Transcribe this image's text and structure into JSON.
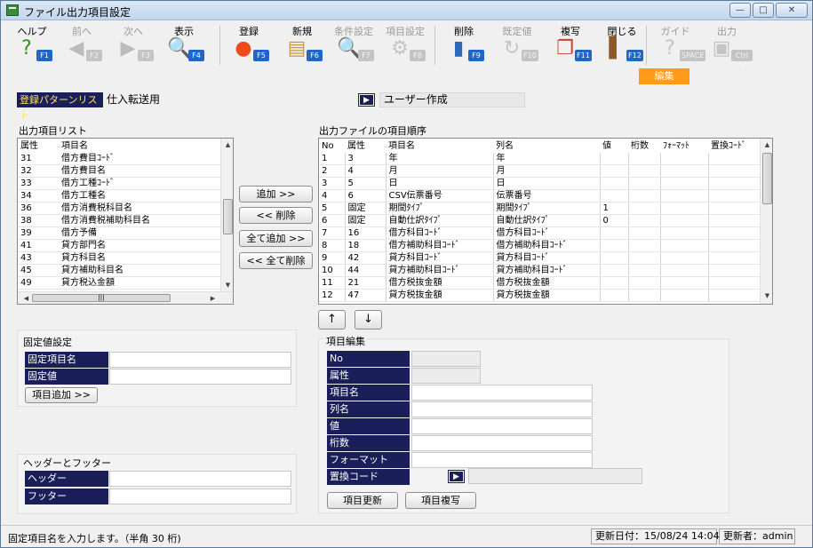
{
  "window": {
    "title": "ファイル出力項目設定",
    "minimize": "—",
    "maximize": "□",
    "close": "✕"
  },
  "toolbar": [
    {
      "label": "ヘルプ",
      "key": "F1",
      "icon": "help-icon",
      "glyph": "?",
      "color": "#3a8a2a",
      "enabled": true
    },
    {
      "label": "前へ",
      "key": "F2",
      "icon": "arrow-left-icon",
      "glyph": "◀",
      "color": "#bcbcbc",
      "enabled": false
    },
    {
      "label": "次へ",
      "key": "F3",
      "icon": "arrow-right-icon",
      "glyph": "▶",
      "color": "#bcbcbc",
      "enabled": false
    },
    {
      "label": "表示",
      "key": "F4",
      "icon": "magnifier-icon",
      "glyph": "🔍",
      "color": "#2a6ab8",
      "enabled": true
    },
    {
      "label": "登録",
      "key": "F5",
      "icon": "ok-icon",
      "glyph": "●",
      "color": "#ee4a1a",
      "enabled": true
    },
    {
      "label": "新規",
      "key": "F6",
      "icon": "new-document-icon",
      "glyph": "▤",
      "color": "#c89a3a",
      "enabled": true
    },
    {
      "label": "条件設定",
      "key": "F7",
      "icon": "search-condition-icon",
      "glyph": "🔍",
      "color": "#c4c4c4",
      "enabled": false
    },
    {
      "label": "項目設定",
      "key": "F8",
      "icon": "gear-icon",
      "glyph": "⚙",
      "color": "#c4c4c4",
      "enabled": false
    },
    {
      "label": "削除",
      "key": "F9",
      "icon": "trash-icon",
      "glyph": "▮",
      "color": "#2a6ab8",
      "enabled": true
    },
    {
      "label": "既定値",
      "key": "F10",
      "icon": "refresh-icon",
      "glyph": "↻",
      "color": "#c4c4c4",
      "enabled": false
    },
    {
      "label": "複写",
      "key": "F11",
      "icon": "copy-icon",
      "glyph": "❐",
      "color": "#d0402a",
      "enabled": true
    },
    {
      "label": "閉じる",
      "key": "F12",
      "icon": "door-icon",
      "glyph": "▌",
      "color": "#8a5a2a",
      "enabled": true
    },
    {
      "label": "ガイド",
      "key": "SPACE",
      "icon": "guide-icon",
      "glyph": "?",
      "color": "#c4c4c4",
      "enabled": false
    },
    {
      "label": "出力",
      "key": "Ctrl P",
      "icon": "output-icon",
      "glyph": "▣",
      "color": "#c4c4c4",
      "enabled": false
    }
  ],
  "mode_tag": "編集",
  "pattern": {
    "label": "登録パターンリスト",
    "value": "仕入転送用",
    "type": "ユーザー作成"
  },
  "output_list": {
    "title": "出力項目リスト",
    "columns": [
      "属性",
      "項目名"
    ],
    "rows": [
      [
        "31",
        "借方費目ｺｰﾄﾞ"
      ],
      [
        "32",
        "借方費目名"
      ],
      [
        "33",
        "借方工種ｺｰﾄﾞ"
      ],
      [
        "34",
        "借方工種名"
      ],
      [
        "36",
        "借方消費税科目名"
      ],
      [
        "38",
        "借方消費税補助科目名"
      ],
      [
        "39",
        "借方予備"
      ],
      [
        "41",
        "貸方部門名"
      ],
      [
        "43",
        "貸方科目名"
      ],
      [
        "45",
        "貸方補助科目名"
      ],
      [
        "49",
        "貸方税込金額"
      ]
    ]
  },
  "move_buttons": {
    "add": "追加 >>",
    "remove": "<< 削除",
    "add_all": "全て追加 >>",
    "remove_all": "<< 全て削除"
  },
  "order_list": {
    "title": "出力ファイルの項目順序",
    "columns": [
      "No",
      "属性",
      "項目名",
      "列名",
      "値",
      "桁数",
      "ﾌｫｰﾏｯﾄ",
      "置換ｺｰﾄﾞ"
    ],
    "rows": [
      [
        "1",
        "3",
        "年",
        "年",
        "",
        "",
        "",
        ""
      ],
      [
        "2",
        "4",
        "月",
        "月",
        "",
        "",
        "",
        ""
      ],
      [
        "3",
        "5",
        "日",
        "日",
        "",
        "",
        "",
        ""
      ],
      [
        "4",
        "6",
        "CSV伝票番号",
        "伝票番号",
        "",
        "",
        "",
        ""
      ],
      [
        "5",
        "固定",
        "期間ﾀｲﾌﾟ",
        "期間ﾀｲﾌﾟ",
        "1",
        "",
        "",
        ""
      ],
      [
        "6",
        "固定",
        "自動仕訳ﾀｲﾌﾟ",
        "自動仕訳ﾀｲﾌﾟ",
        "0",
        "",
        "",
        ""
      ],
      [
        "7",
        "16",
        "借方科目ｺｰﾄﾞ",
        "借方科目ｺｰﾄﾞ",
        "",
        "",
        "",
        ""
      ],
      [
        "8",
        "18",
        "借方補助科目ｺｰﾄﾞ",
        "借方補助科目ｺｰﾄﾞ",
        "",
        "",
        "",
        ""
      ],
      [
        "9",
        "42",
        "貸方科目ｺｰﾄﾞ",
        "貸方科目ｺｰﾄﾞ",
        "",
        "",
        "",
        ""
      ],
      [
        "10",
        "44",
        "貸方補助科目ｺｰﾄﾞ",
        "貸方補助科目ｺｰﾄﾞ",
        "",
        "",
        "",
        ""
      ],
      [
        "11",
        "21",
        "借方税抜金額",
        "借方税抜金額",
        "",
        "",
        "",
        ""
      ],
      [
        "12",
        "47",
        "貸方税抜金額",
        "貸方税抜金額",
        "",
        "",
        "",
        ""
      ]
    ],
    "up": "↑",
    "down": "↓"
  },
  "fixed": {
    "title": "固定値設定",
    "name_label": "固定項目名",
    "value_label": "固定値",
    "name_value": "",
    "value_value": "",
    "add_button": "項目追加 >>"
  },
  "header_footer": {
    "title": "ヘッダーとフッター",
    "header_label": "ヘッダー",
    "footer_label": "フッター",
    "header_value": "",
    "footer_value": ""
  },
  "edit": {
    "title": "項目編集",
    "fields": [
      "No",
      "属性",
      "項目名",
      "列名",
      "値",
      "桁数",
      "フォーマット",
      "置換コード"
    ],
    "update_button": "項目更新",
    "copy_button": "項目複写"
  },
  "status": {
    "message": "固定項目名を入力します。（半角 30 桁)",
    "updated": "更新日付：15/08/24 14:04",
    "updater": "更新者：admin"
  }
}
